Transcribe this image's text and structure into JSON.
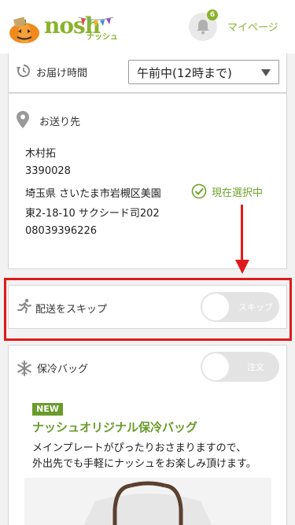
{
  "header": {
    "logo_text": "nosh",
    "logo_subtext": "ナッシュ",
    "notification_count": "6",
    "mypage_label": "マイページ"
  },
  "delivery_time": {
    "label": "お届け時間",
    "selected_value": "午前中(12時まで)"
  },
  "address": {
    "label": "お送り先",
    "name": "木村拓",
    "postal_code": "3390028",
    "line1": "埼玉県 さいたま市岩槻区美園",
    "line2": "東2-18-10 サクシード司202",
    "phone": "08039396226",
    "selected_status": "現在選択中"
  },
  "skip": {
    "label": "配送をスキップ",
    "toggle_label": "スキップ"
  },
  "cool_bag": {
    "label": "保冷バッグ",
    "toggle_label": "注文",
    "badge": "NEW",
    "title": "ナッシュオリジナル保冷バッグ",
    "description_line1": "メインプレートがぴったりおさまりますので、",
    "description_line2": "外出先でも手軽にナッシュをお楽しみ頂けます。"
  },
  "colors": {
    "brand_green": "#8ab32b",
    "highlight_red": "#e01a1a"
  }
}
